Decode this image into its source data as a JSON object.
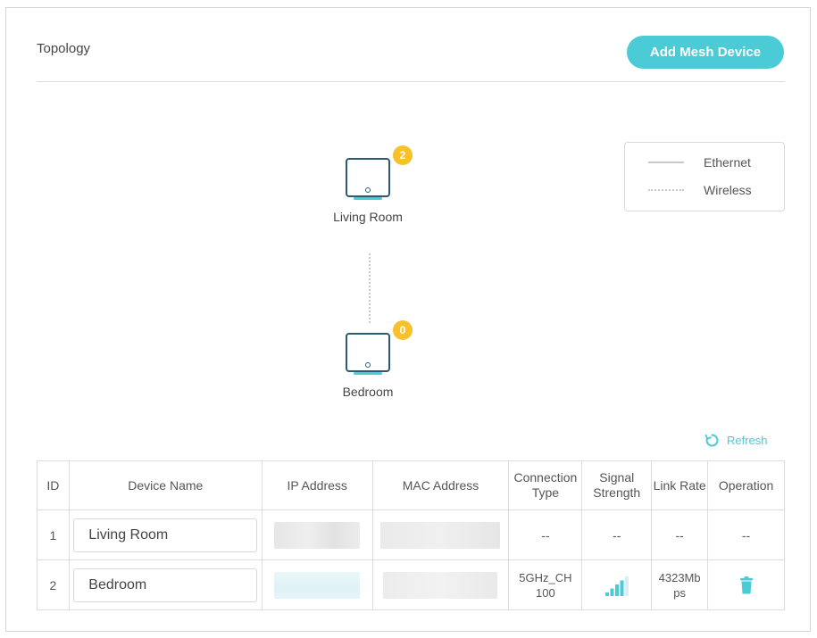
{
  "header": {
    "title": "Topology",
    "add_button_label": "Add Mesh Device"
  },
  "legend": {
    "ethernet_label": "Ethernet",
    "wireless_label": "Wireless"
  },
  "topology": {
    "nodes": [
      {
        "name": "Living Room",
        "badge": "2"
      },
      {
        "name": "Bedroom",
        "badge": "0"
      }
    ]
  },
  "refresh_label": "Refresh",
  "table": {
    "headers": {
      "id": "ID",
      "device_name": "Device Name",
      "ip_address": "IP Address",
      "mac_address": "MAC Address",
      "connection_type": "Connection Type",
      "signal_strength": "Signal Strength",
      "link_rate": "Link Rate",
      "operation": "Operation"
    },
    "rows": [
      {
        "id": "1",
        "device_name": "Living Room",
        "connection_type": "--",
        "signal_strength": "--",
        "link_rate": "--",
        "operation": "--"
      },
      {
        "id": "2",
        "device_name": "Bedroom",
        "connection_type": "5GHz_CH100",
        "signal_strength_level": 4,
        "link_rate": "4323Mbps"
      }
    ]
  },
  "colors": {
    "accent": "#4acbd6",
    "badge": "#f6c12a",
    "device_outline": "#2b5a72"
  },
  "icons": {
    "device": "mesh-router-icon",
    "refresh": "refresh-icon",
    "signal": "signal-strength-icon",
    "delete": "trash-icon"
  }
}
